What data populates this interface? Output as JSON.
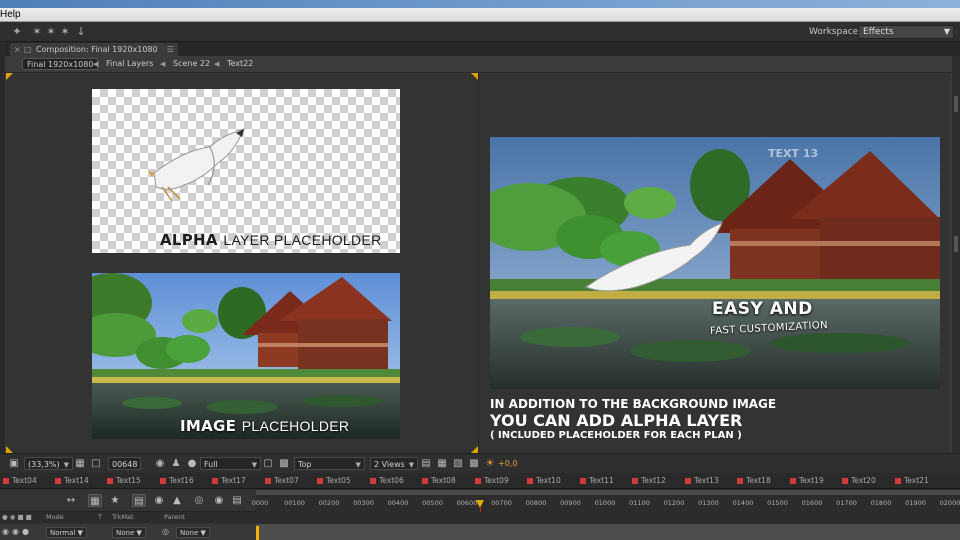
{
  "app": {
    "menu_visible": "Help"
  },
  "toolbar": {
    "workspace_label": "Workspace:",
    "workspace_value": "Effects"
  },
  "panel": {
    "tab_title": "Composition: Final 1920x1080"
  },
  "breadcrumbs": [
    "Final 1920x1080",
    "Final Layers",
    "Scene 22",
    "Text22"
  ],
  "viewer": {
    "alpha_placeholder_label_bold": "ALPHA",
    "alpha_placeholder_label_rest": "LAYER PLACEHOLDER",
    "image_placeholder_label_bold": "IMAGE",
    "image_placeholder_label_rest": "PLACEHOLDER",
    "preview_tag": "TEXT 13",
    "preview_headline": "EASY AND",
    "preview_subline": "FAST CUSTOMIZATION",
    "caption_line1": "IN ADDITION TO THE BACKGROUND IMAGE",
    "caption_line2": "YOU CAN ADD ALPHA LAYER",
    "caption_line3": "(   INCLUDED PLACEHOLDER FOR EACH PLAN   )"
  },
  "viewer_controls": {
    "zoom": "(33,3%)",
    "timecode": "00648",
    "resolution": "Full",
    "view": "Top",
    "views_layout": "2 Views",
    "exposure": "+0,0"
  },
  "timeline_tabs": [
    "Text04",
    "Text14",
    "Text15",
    "Text16",
    "Text17",
    "Text07",
    "Text05",
    "Text06",
    "Text08",
    "Text09",
    "Text10",
    "Text11",
    "Text12",
    "Text13",
    "Text18",
    "Text19",
    "Text20",
    "Text21"
  ],
  "ruler_ticks": [
    "0000",
    "00100",
    "00200",
    "00300",
    "00400",
    "00500",
    "00600",
    "00700",
    "00800",
    "00900",
    "01000",
    "01100",
    "01200",
    "01300",
    "01400",
    "01500",
    "01600",
    "01700",
    "01800",
    "01900",
    "02000"
  ],
  "timeline_header": {
    "mode": "Mode",
    "t": "T",
    "trkmat": "TrkMat",
    "parent": "Parent"
  },
  "timeline_row": {
    "mode_value": "Normal",
    "trkmat_value": "None",
    "parent_value": "None"
  },
  "colors": {
    "accent_orange": "#e0a300",
    "label_red": "#d23b3b",
    "panel_bg": "#333333"
  }
}
